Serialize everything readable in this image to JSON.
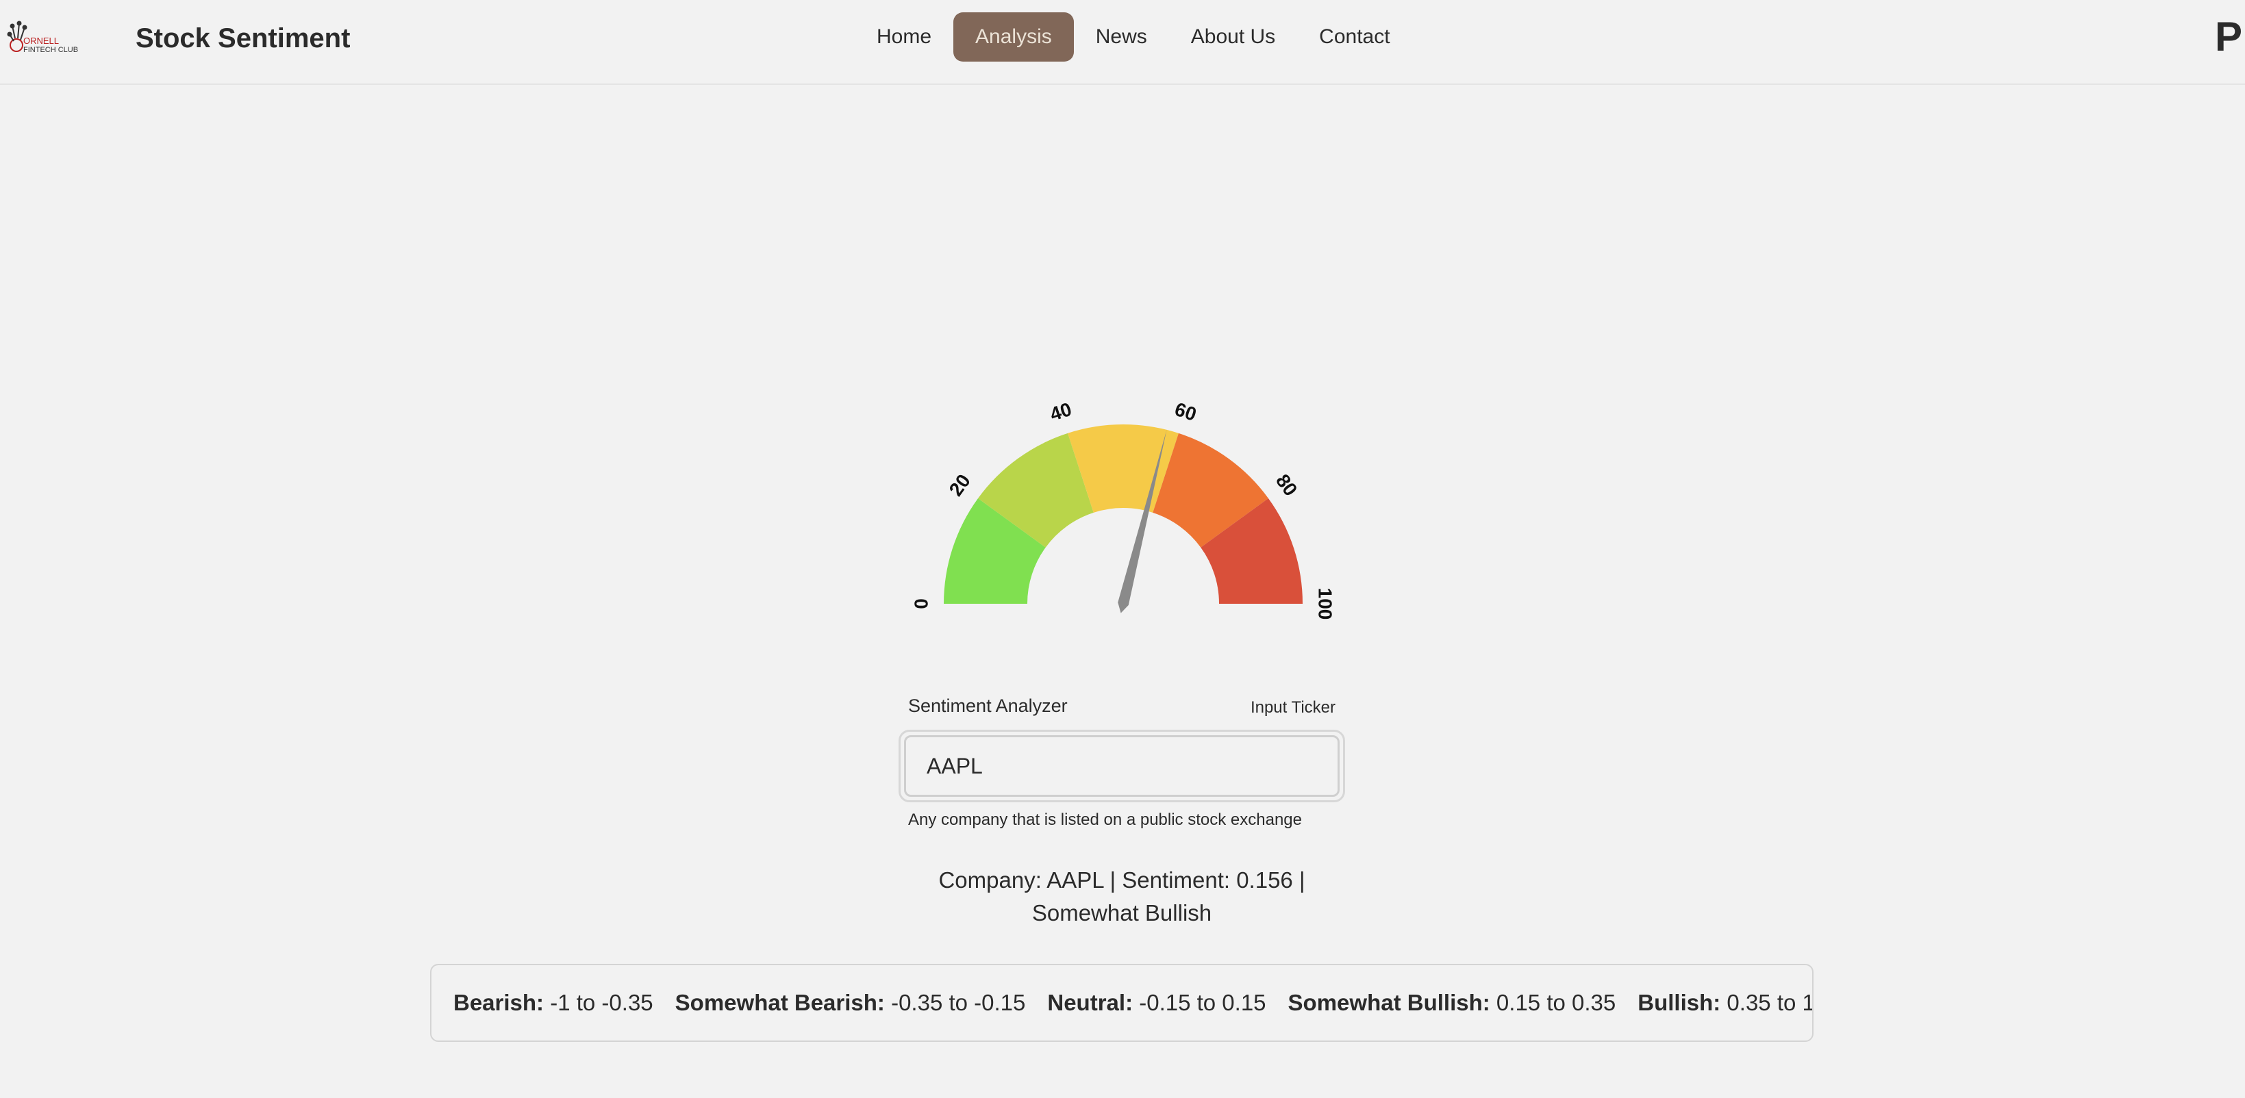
{
  "header": {
    "logo_text": "CORNELL FINTECH CLUB",
    "brand": "Stock Sentiment",
    "nav": [
      {
        "label": "Home",
        "active": false
      },
      {
        "label": "Analysis",
        "active": true
      },
      {
        "label": "News",
        "active": false
      },
      {
        "label": "About Us",
        "active": false
      },
      {
        "label": "Contact",
        "active": false
      }
    ],
    "corner_letter": "P"
  },
  "gauge": {
    "ticks": [
      "0",
      "20",
      "40",
      "60",
      "80",
      "100"
    ],
    "needle_value": 57.8,
    "segment_colors": [
      "#80e050",
      "#b9d54a",
      "#f5ca48",
      "#ee7433",
      "#d9503a"
    ],
    "needle_color": "#8a8a8a"
  },
  "analyzer": {
    "label": "Sentiment Analyzer",
    "input_hint": "Input Ticker",
    "ticker_value": "AAPL",
    "helper": "Any company that is listed on a public stock exchange"
  },
  "result": {
    "line1": "Company: AAPL | Sentiment: 0.156 |",
    "line2": "Somewhat Bullish"
  },
  "legend": [
    {
      "name": "Bearish:",
      "range": "-1 to -0.35"
    },
    {
      "name": "Somewhat Bearish:",
      "range": "-0.35 to -0.15"
    },
    {
      "name": "Neutral:",
      "range": "-0.15 to 0.15"
    },
    {
      "name": "Somewhat Bullish:",
      "range": "0.15 to 0.35"
    },
    {
      "name": "Bullish:",
      "range": "0.35 to 1"
    }
  ]
}
